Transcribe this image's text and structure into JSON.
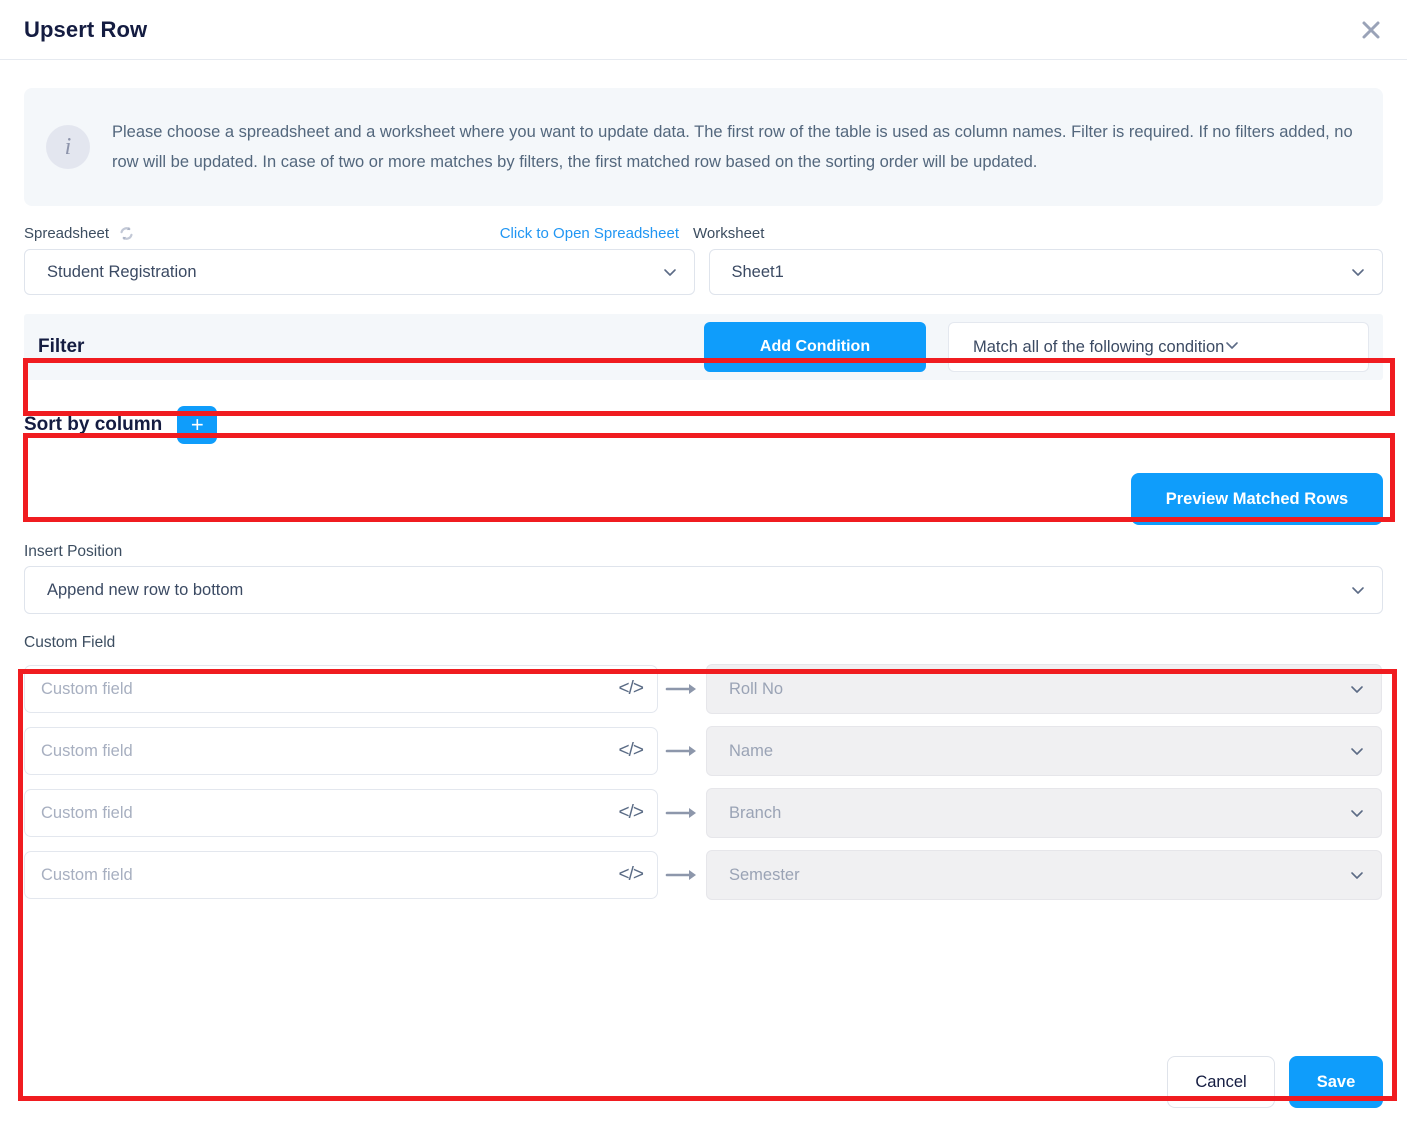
{
  "header": {
    "title": "Upsert Row",
    "close_icon": "close-icon"
  },
  "info": {
    "icon": "info-icon",
    "text": "Please choose a spreadsheet and a worksheet where you want to update data. The first row of the table is used as column names. Filter is required. If no filters added, no row will be updated. In case of two or more matches by filters, the first matched row based on the sorting order will be updated."
  },
  "source": {
    "spreadsheet_label": "Spreadsheet",
    "refresh_icon": "refresh-icon",
    "open_link": "Click to Open Spreadsheet",
    "worksheet_label": "Worksheet",
    "spreadsheet_value": "Student Registration",
    "worksheet_value": "Sheet1"
  },
  "filter": {
    "label": "Filter",
    "add_condition_label": "Add Condition",
    "match_value": "Match all of the following condition"
  },
  "sort": {
    "label": "Sort by column",
    "add_label": "+"
  },
  "preview": {
    "label": "Preview Matched Rows"
  },
  "insert": {
    "label": "Insert Position",
    "value": "Append new row to bottom"
  },
  "custom_field": {
    "label": "Custom Field",
    "input_placeholder": "Custom field",
    "code_icon": "</>",
    "rows": [
      {
        "column": "Roll No"
      },
      {
        "column": "Name"
      },
      {
        "column": "Branch"
      },
      {
        "column": "Semester"
      }
    ]
  },
  "footer": {
    "cancel_label": "Cancel",
    "save_label": "Save"
  },
  "colors": {
    "accent": "#0f9dfb",
    "link": "#2196f3",
    "highlight": "#f01c20",
    "banner_bg": "#f4f7fa",
    "title": "#141c41"
  }
}
